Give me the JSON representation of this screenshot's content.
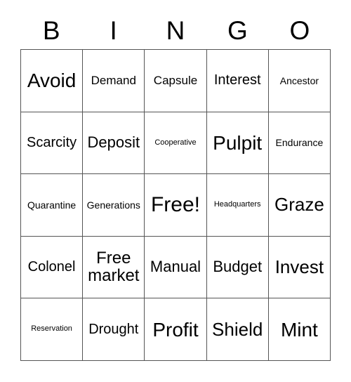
{
  "card": {
    "title_letters": [
      "B",
      "I",
      "N",
      "G",
      "O"
    ],
    "border_color": "#555555",
    "text_color": "#000000",
    "background_color": "#ffffff",
    "columns": 5,
    "rows": 5,
    "free_space": "Free!",
    "free_space_position": {
      "row": 3,
      "column": 3
    },
    "cells": [
      [
        {
          "text": "Avoid",
          "size": "fs-4xl"
        },
        {
          "text": "Demand",
          "size": "fs-m"
        },
        {
          "text": "Capsule",
          "size": "fs-m"
        },
        {
          "text": "Interest",
          "size": "fs-l"
        },
        {
          "text": "Ancestor",
          "size": "fs-s"
        }
      ],
      [
        {
          "text": "Scarcity",
          "size": "fs-l"
        },
        {
          "text": "Deposit",
          "size": "fs-xl"
        },
        {
          "text": "Cooperative",
          "size": "fs-xs"
        },
        {
          "text": "Pulpit",
          "size": "fs-4xl"
        },
        {
          "text": "Endurance",
          "size": "fs-s"
        }
      ],
      [
        {
          "text": "Quarantine",
          "size": "fs-s"
        },
        {
          "text": "Generations",
          "size": "fs-s"
        },
        {
          "text": "Free!",
          "size": "fs-5xl"
        },
        {
          "text": "Headquarters",
          "size": "fs-xs"
        },
        {
          "text": "Graze",
          "size": "fs-3xl"
        }
      ],
      [
        {
          "text": "Colonel",
          "size": "fs-l"
        },
        {
          "text": "Free market",
          "size": "fs-2xl"
        },
        {
          "text": "Manual",
          "size": "fs-xl"
        },
        {
          "text": "Budget",
          "size": "fs-xl"
        },
        {
          "text": "Invest",
          "size": "fs-3xl"
        }
      ],
      [
        {
          "text": "Reservation",
          "size": "fs-xs"
        },
        {
          "text": "Drought",
          "size": "fs-l"
        },
        {
          "text": "Profit",
          "size": "fs-4xl"
        },
        {
          "text": "Shield",
          "size": "fs-3xl"
        },
        {
          "text": "Mint",
          "size": "fs-4xl"
        }
      ]
    ]
  }
}
